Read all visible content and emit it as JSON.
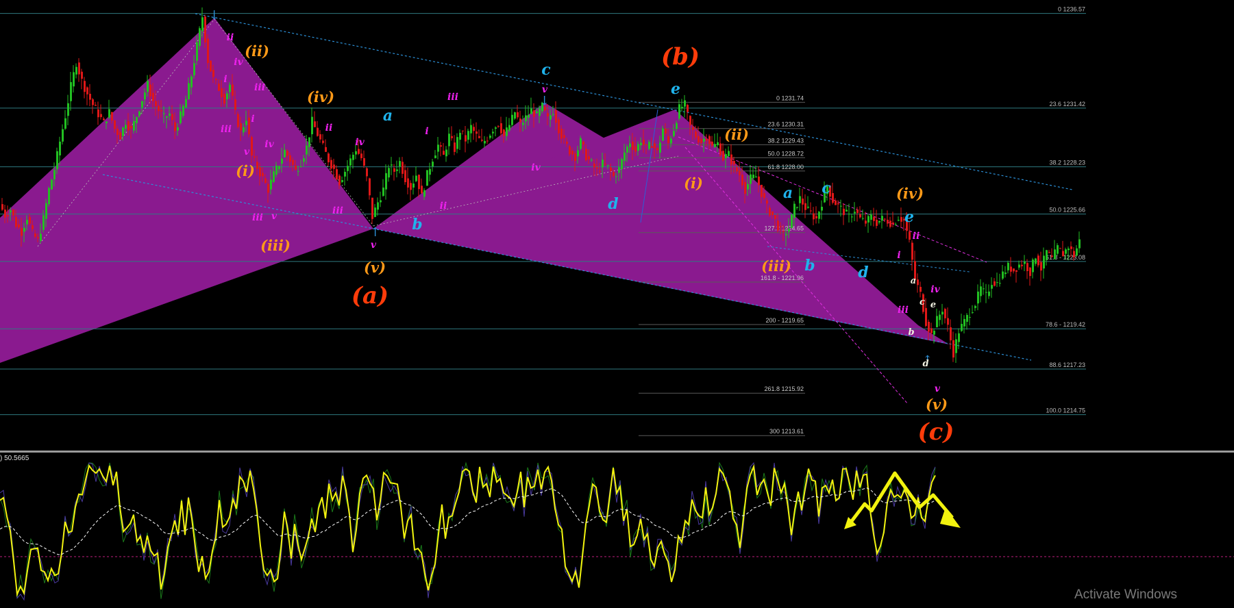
{
  "chart_data": [
    {
      "type": "candlestick",
      "title": "",
      "xlabel": "",
      "ylabel": "",
      "ylim": [
        1212.8,
        1237.3
      ],
      "grid": false,
      "ohlc_path": [
        [
          0,
          1226.2
        ],
        [
          8,
          1225.6
        ],
        [
          16,
          1225.9
        ],
        [
          24,
          1225.1
        ],
        [
          32,
          1224.7
        ],
        [
          40,
          1225.5
        ],
        [
          48,
          1224.6
        ],
        [
          56,
          1224.2
        ],
        [
          64,
          1225.4
        ],
        [
          72,
          1227.0
        ],
        [
          80,
          1228.1
        ],
        [
          88,
          1229.6
        ],
        [
          96,
          1231.0
        ],
        [
          104,
          1232.6
        ],
        [
          112,
          1233.9
        ],
        [
          120,
          1232.9
        ],
        [
          128,
          1232.2
        ],
        [
          136,
          1231.6
        ],
        [
          144,
          1231.1
        ],
        [
          152,
          1230.6
        ],
        [
          160,
          1231.2
        ],
        [
          168,
          1230.3
        ],
        [
          176,
          1229.9
        ],
        [
          184,
          1230.7
        ],
        [
          192,
          1230.2
        ],
        [
          200,
          1231.0
        ],
        [
          208,
          1231.9
        ],
        [
          216,
          1232.7
        ],
        [
          224,
          1231.8
        ],
        [
          232,
          1231.3
        ],
        [
          240,
          1230.9
        ],
        [
          248,
          1231.1
        ],
        [
          256,
          1230.2
        ],
        [
          264,
          1231.0
        ],
        [
          272,
          1231.9
        ],
        [
          280,
          1233.2
        ],
        [
          288,
          1234.8
        ],
        [
          296,
          1236.4
        ],
        [
          304,
          1234.0
        ],
        [
          312,
          1233.0
        ],
        [
          320,
          1232.5
        ],
        [
          328,
          1231.9
        ],
        [
          336,
          1232.7
        ],
        [
          344,
          1231.1
        ],
        [
          352,
          1230.1
        ],
        [
          360,
          1230.9
        ],
        [
          368,
          1228.8
        ],
        [
          376,
          1228.2
        ],
        [
          384,
          1227.6
        ],
        [
          392,
          1227.0
        ],
        [
          400,
          1227.8
        ],
        [
          408,
          1228.4
        ],
        [
          416,
          1229.1
        ],
        [
          424,
          1228.6
        ],
        [
          432,
          1228.0
        ],
        [
          440,
          1228.5
        ],
        [
          448,
          1229.3
        ],
        [
          456,
          1230.7
        ],
        [
          464,
          1230.0
        ],
        [
          472,
          1229.3
        ],
        [
          480,
          1228.6
        ],
        [
          488,
          1228.1
        ],
        [
          496,
          1227.4
        ],
        [
          504,
          1228.0
        ],
        [
          512,
          1228.6
        ],
        [
          520,
          1229.2
        ],
        [
          528,
          1228.7
        ],
        [
          536,
          1227.6
        ],
        [
          544,
          1225.5
        ],
        [
          552,
          1226.3
        ],
        [
          560,
          1227.0
        ],
        [
          568,
          1228.3
        ],
        [
          576,
          1228.0
        ],
        [
          584,
          1228.5
        ],
        [
          592,
          1227.6
        ],
        [
          600,
          1227.1
        ],
        [
          608,
          1227.8
        ],
        [
          616,
          1226.6
        ],
        [
          624,
          1227.8
        ],
        [
          632,
          1228.7
        ],
        [
          640,
          1229.4
        ],
        [
          648,
          1228.8
        ],
        [
          656,
          1229.9
        ],
        [
          664,
          1229.2
        ],
        [
          672,
          1230.2
        ],
        [
          680,
          1229.7
        ],
        [
          688,
          1230.4
        ],
        [
          696,
          1229.9
        ],
        [
          704,
          1229.5
        ],
        [
          712,
          1229.8
        ],
        [
          720,
          1230.3
        ],
        [
          728,
          1230.6
        ],
        [
          736,
          1229.9
        ],
        [
          744,
          1230.5
        ],
        [
          752,
          1231.2
        ],
        [
          760,
          1230.5
        ],
        [
          768,
          1230.9
        ],
        [
          776,
          1231.3
        ],
        [
          784,
          1231.0
        ],
        [
          792,
          1231.5
        ],
        [
          800,
          1230.8
        ],
        [
          808,
          1231.3
        ],
        [
          816,
          1230.3
        ],
        [
          824,
          1229.6
        ],
        [
          832,
          1229.1
        ],
        [
          840,
          1228.8
        ],
        [
          848,
          1229.6
        ],
        [
          856,
          1228.8
        ],
        [
          864,
          1228.4
        ],
        [
          872,
          1228.0
        ],
        [
          880,
          1228.4
        ],
        [
          888,
          1228.2
        ],
        [
          896,
          1227.7
        ],
        [
          904,
          1228.1
        ],
        [
          912,
          1229.0
        ],
        [
          920,
          1229.6
        ],
        [
          928,
          1229.1
        ],
        [
          936,
          1229.7
        ],
        [
          944,
          1229.2
        ],
        [
          952,
          1229.5
        ],
        [
          960,
          1229.0
        ],
        [
          968,
          1230.3
        ],
        [
          976,
          1229.5
        ],
        [
          984,
          1230.3
        ],
        [
          992,
          1231.4
        ],
        [
          1000,
          1231.6
        ],
        [
          1008,
          1230.4
        ],
        [
          1016,
          1229.9
        ],
        [
          1024,
          1229.6
        ],
        [
          1032,
          1229.9
        ],
        [
          1040,
          1229.3
        ],
        [
          1048,
          1229.5
        ],
        [
          1056,
          1228.7
        ],
        [
          1064,
          1228.9
        ],
        [
          1072,
          1228.2
        ],
        [
          1080,
          1227.8
        ],
        [
          1088,
          1227.0
        ],
        [
          1096,
          1227.6
        ],
        [
          1104,
          1227.7
        ],
        [
          1112,
          1226.8
        ],
        [
          1120,
          1226.0
        ],
        [
          1128,
          1225.6
        ],
        [
          1136,
          1225.0
        ],
        [
          1144,
          1224.5
        ],
        [
          1152,
          1224.9
        ],
        [
          1160,
          1226.0
        ],
        [
          1168,
          1226.5
        ],
        [
          1176,
          1226.0
        ],
        [
          1184,
          1225.7
        ],
        [
          1192,
          1225.4
        ],
        [
          1200,
          1226.3
        ],
        [
          1208,
          1227.2
        ],
        [
          1216,
          1226.4
        ],
        [
          1224,
          1226.1
        ],
        [
          1232,
          1225.8
        ],
        [
          1240,
          1225.5
        ],
        [
          1248,
          1225.9
        ],
        [
          1256,
          1225.4
        ],
        [
          1264,
          1225.2
        ],
        [
          1272,
          1225.5
        ],
        [
          1280,
          1225.2
        ],
        [
          1288,
          1225.4
        ],
        [
          1296,
          1225.3
        ],
        [
          1304,
          1225.1
        ],
        [
          1312,
          1225.5
        ],
        [
          1320,
          1225.3
        ],
        [
          1328,
          1224.1
        ],
        [
          1336,
          1222.1
        ],
        [
          1344,
          1221.3
        ],
        [
          1352,
          1219.8
        ],
        [
          1360,
          1219.1
        ],
        [
          1368,
          1219.9
        ],
        [
          1376,
          1220.5
        ],
        [
          1384,
          1219.5
        ],
        [
          1392,
          1218.1
        ],
        [
          1400,
          1219.3
        ],
        [
          1408,
          1219.8
        ],
        [
          1416,
          1220.3
        ],
        [
          1424,
          1220.8
        ],
        [
          1432,
          1221.6
        ],
        [
          1440,
          1221.2
        ],
        [
          1448,
          1222.0
        ],
        [
          1456,
          1221.9
        ],
        [
          1464,
          1222.4
        ],
        [
          1472,
          1222.8
        ],
        [
          1480,
          1222.6
        ],
        [
          1488,
          1222.9
        ],
        [
          1496,
          1223.0
        ],
        [
          1504,
          1222.5
        ],
        [
          1512,
          1223.4
        ],
        [
          1520,
          1222.7
        ],
        [
          1528,
          1223.6
        ],
        [
          1536,
          1223.2
        ],
        [
          1544,
          1223.8
        ],
        [
          1552,
          1223.5
        ],
        [
          1560,
          1223.9
        ],
        [
          1568,
          1223.4
        ],
        [
          1576,
          1224.2
        ]
      ],
      "levels_right": [
        {
          "ratio": "0",
          "price": "1236.57",
          "text": "0 1236.57"
        },
        {
          "ratio": "23.6",
          "price": "1231.42",
          "text": "23.6 1231.42"
        },
        {
          "ratio": "38.2",
          "price": "1228.23",
          "text": "38.2 1228.23"
        },
        {
          "ratio": "50.0",
          "price": "1225.66",
          "text": "50.0 1225.66"
        },
        {
          "ratio": "61.8",
          "price": "1223.08",
          "text": "61.8 - 1223.08"
        },
        {
          "ratio": "78.6",
          "price": "1219.42",
          "text": "78.6 - 1219.42"
        },
        {
          "ratio": "88.6",
          "price": "1217.23",
          "text": "88.6 1217.23"
        },
        {
          "ratio": "100.0",
          "price": "1214.75",
          "text": "100.0 1214.75"
        }
      ],
      "levels_mid": [
        {
          "ratio": "0",
          "price": "1231.74",
          "text": "0 1231.74"
        },
        {
          "ratio": "23.6",
          "price": "1230.31",
          "text": "23.6 1230.31"
        },
        {
          "ratio": "38.2",
          "price": "1229.43",
          "text": "38.2 1229.43"
        },
        {
          "ratio": "50.0",
          "price": "1228.72",
          "text": "50.0 1228.72"
        },
        {
          "ratio": "61.8",
          "price": "1228.00",
          "text": "61.8 1228.00"
        },
        {
          "ratio": "127.2",
          "price": "1224.65",
          "text": "127.2 1224.65"
        },
        {
          "ratio": "161.8",
          "price": "1221.96",
          "text": "161.8 - 1221.96"
        },
        {
          "ratio": "200",
          "price": "1219.65",
          "text": "200 - 1219.65"
        },
        {
          "ratio": "261.8",
          "price": "1215.92",
          "text": "261.8 1215.92"
        },
        {
          "ratio": "300",
          "price": "1213.61",
          "text": "300 1213.61"
        }
      ],
      "wave_labels_major": [
        "(a)",
        "(b)",
        "(c)"
      ],
      "wave_labels_minor": [
        "(i)",
        "(ii)",
        "(iii)",
        "(iv)",
        "(v)"
      ],
      "wave_labels_sub": [
        "a",
        "b",
        "c",
        "d",
        "e"
      ],
      "wave_labels_micro": [
        "i",
        "ii",
        "iii",
        "iv",
        "v"
      ]
    },
    {
      "type": "line",
      "title": "",
      "xlabel": "",
      "ylabel": "",
      "value_label": ") 50.5665",
      "ylim": [
        0,
        100
      ],
      "midline": 50
    }
  ],
  "colors": {
    "candle_up": "#22c022",
    "candle_down": "#e01818",
    "pattern_fill": "#8a1a8f",
    "level_line": "#2f7a80",
    "channel": "#2c8fd6",
    "wave_orange": "#ff9a18",
    "wave_red": "#ff3c0a",
    "wave_cyan": "#1fb3ec",
    "wave_magenta": "#ee22ee",
    "oscillator": "#f2f20e",
    "oscillator_signal": "#ffffff"
  },
  "watermark": "Activate Windows"
}
